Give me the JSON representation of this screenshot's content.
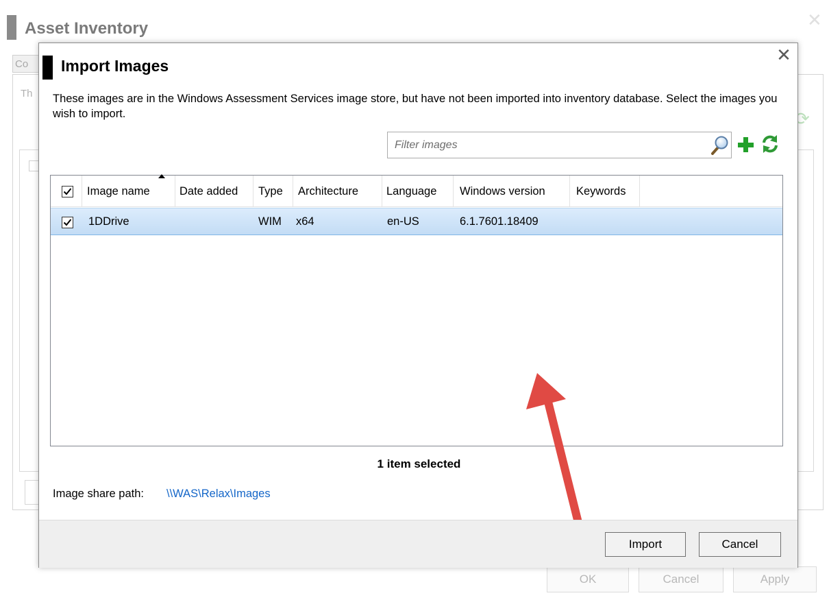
{
  "background_window": {
    "title": "Asset Inventory",
    "tab_label": "Co",
    "panel_text": "Th",
    "footer_buttons": [
      "OK",
      "Cancel",
      "Apply"
    ]
  },
  "dialog": {
    "title": "Import Images",
    "close_icon": "close-icon",
    "description": "These images are in the Windows Assessment Services image store, but have not been imported into inventory database. Select the images you wish to import.",
    "filter": {
      "placeholder": "Filter images",
      "value": ""
    },
    "toolbar_icons": [
      "search-icon",
      "add-icon",
      "refresh-icon"
    ],
    "columns": [
      "Image name",
      "Date added",
      "Type",
      "Architecture",
      "Language",
      "Windows version",
      "Keywords"
    ],
    "header_checked": true,
    "sort_column": "Image name",
    "rows": [
      {
        "checked": true,
        "image_name": "1DDrive",
        "date_added": "",
        "type": "WIM",
        "architecture": "x64",
        "language": "en-US",
        "windows_version": "6.1.7601.18409",
        "keywords": ""
      }
    ],
    "status": "1 item selected",
    "share_path_label": "Image share path:",
    "share_path": "\\\\WAS\\Relax\\Images",
    "buttons": {
      "import": "Import",
      "cancel": "Cancel"
    },
    "annotation_color": "#e04a44"
  }
}
